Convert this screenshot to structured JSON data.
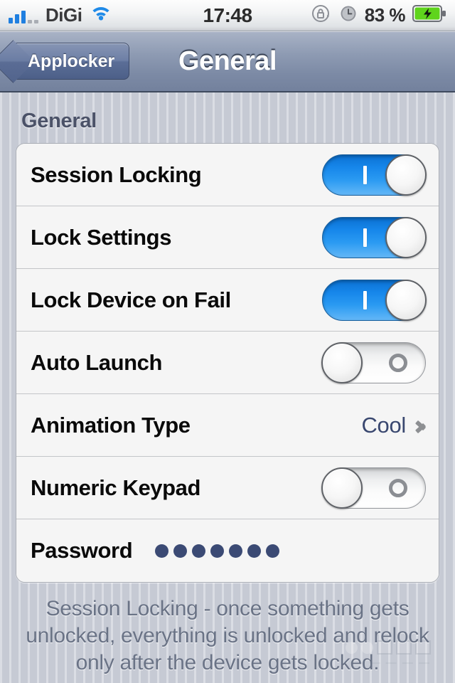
{
  "status_bar": {
    "carrier": "DiGi",
    "signal_icon": "signal-bars-icon",
    "signal_bars_filled": 3,
    "signal_bars_empty": 2,
    "wifi_icon": "wifi-icon",
    "time": "17:48",
    "rotation_lock_icon": "rotation-lock-icon",
    "alarm_icon": "alarm-clock-icon",
    "battery_percent": "83 %",
    "battery_icon": "battery-charging-icon",
    "battery_color": "#5fd41c"
  },
  "navbar": {
    "back_label": "Applocker",
    "title": "General",
    "accent": "#5b6e97"
  },
  "section": {
    "header": "General"
  },
  "rows": [
    {
      "label": "Session Locking",
      "control": "switch",
      "state": "on",
      "state_mark": "|"
    },
    {
      "label": "Lock Settings",
      "control": "switch",
      "state": "on",
      "state_mark": "|"
    },
    {
      "label": "Lock Device on Fail",
      "control": "switch",
      "state": "on",
      "state_mark": "|"
    },
    {
      "label": "Auto Launch",
      "control": "switch",
      "state": "off",
      "state_mark": "O"
    },
    {
      "label": "Animation Type",
      "control": "disclosure",
      "value": "Cool",
      "chevron_icon": "chevron-right-icon"
    },
    {
      "label": "Numeric Keypad",
      "control": "switch",
      "state": "off",
      "state_mark": "O"
    },
    {
      "label": "Password",
      "control": "masked-value",
      "masked_dots": 7
    }
  ],
  "footer": {
    "note": "Session Locking - once something gets unlocked, everything is unlocked and relock only after the device gets locked."
  },
  "colors": {
    "switch_on": "#1686ea",
    "row_background": "#f5f5f5",
    "page_background": "#c6cad4",
    "value_text": "#39476f",
    "section_header_text": "#4b5268",
    "footer_text": "#6a7386"
  }
}
